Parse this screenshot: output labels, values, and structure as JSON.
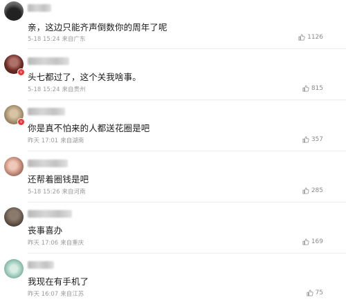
{
  "comments": [
    {
      "text": "亲，这边只能齐声倒数你的周年了呢",
      "time": "5-18 15:24",
      "location": "来自广东",
      "likes": "1126",
      "avatar_color": "#3a3a3a",
      "has_badge": false
    },
    {
      "text": "头七都过了，这个关我啥事。",
      "time": "5-18 15:24",
      "location": "来自贵州",
      "likes": "815",
      "avatar_color": "#7a3a2e",
      "has_badge": true
    },
    {
      "text": "你是真不怕来的人都送花圈是吧",
      "time": "昨天 17:01",
      "location": "来自湖南",
      "likes": "357",
      "avatar_color": "#a08a6a",
      "has_badge": true
    },
    {
      "text": "还帮着圈钱是吧",
      "time": "5-18 15:26",
      "location": "来自河南",
      "likes": "285",
      "avatar_color": "#c48a78",
      "has_badge": false
    },
    {
      "text": "丧事喜办",
      "time": "昨天 17:06",
      "location": "来自重庆",
      "likes": "169",
      "avatar_color": "#6a5a4e",
      "has_badge": false
    },
    {
      "text": "我现在有手机了",
      "time": "昨天 16:07",
      "location": "来自江苏",
      "likes": "75",
      "avatar_color": "#7ab0a0",
      "has_badge": false
    }
  ]
}
